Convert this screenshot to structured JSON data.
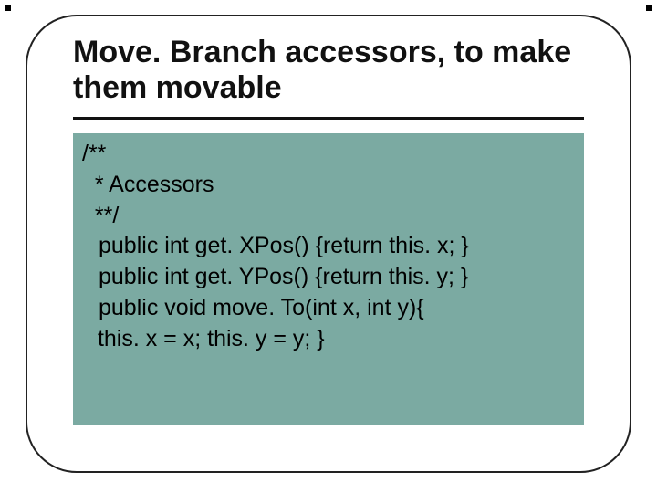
{
  "slide": {
    "title": "Move. Branch accessors, to make them movable"
  },
  "code": {
    "lines": [
      "/**",
      "  * Accessors",
      "  **/",
      "public int get. XPos() {return this. x; }",
      "public int get. YPos() {return this. y; }",
      "public void move. To(int x, int y){",
      " this. x = x; this. y = y; }"
    ]
  }
}
